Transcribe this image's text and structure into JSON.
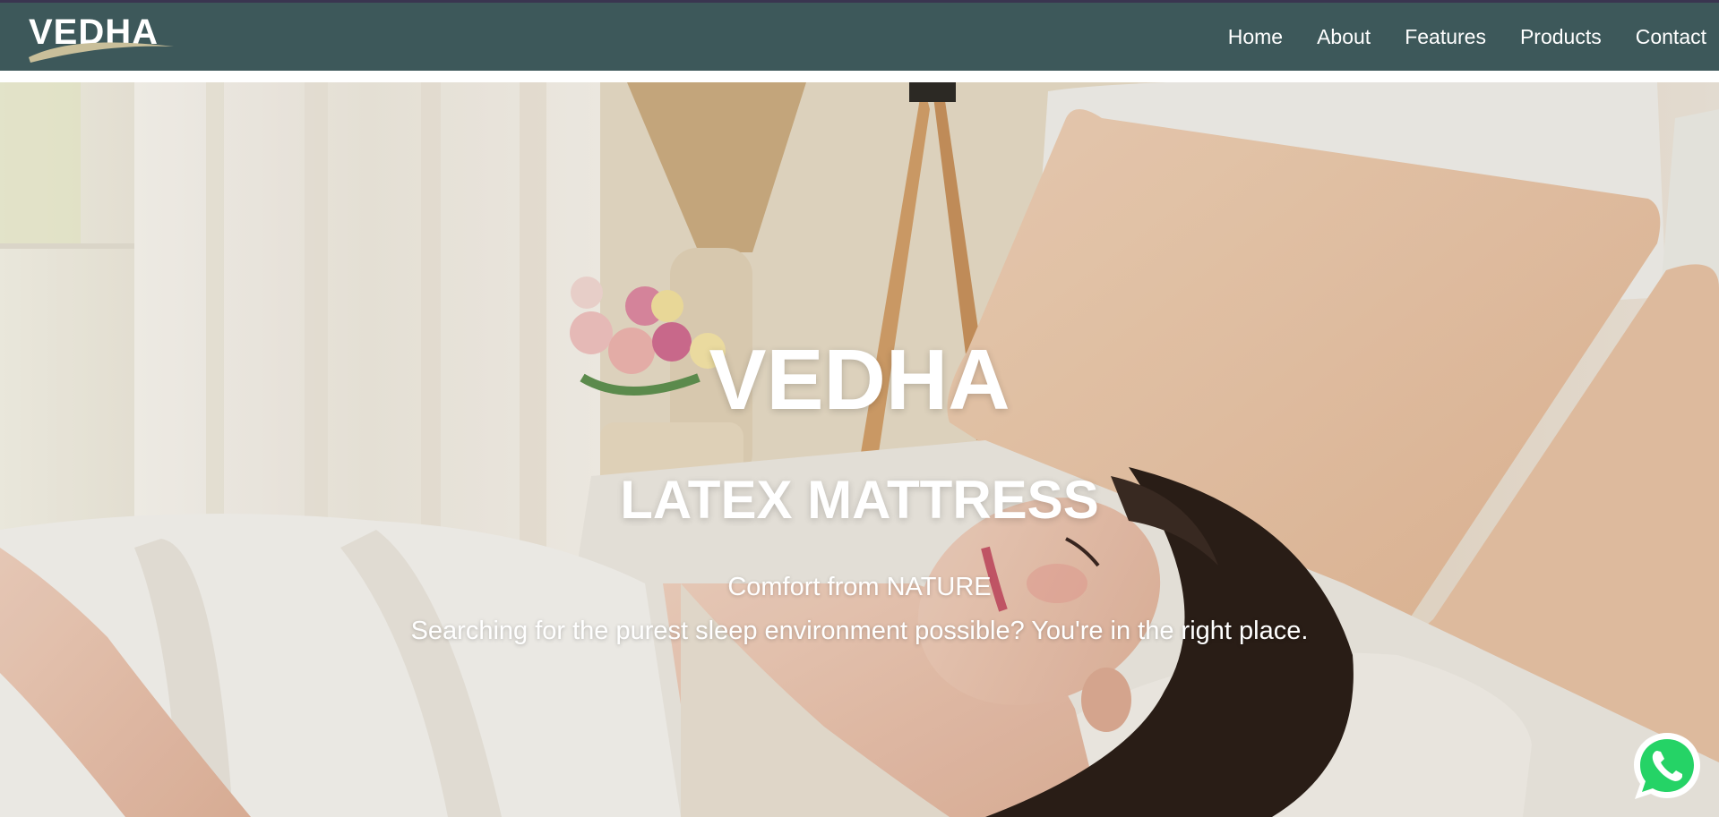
{
  "navbar": {
    "logo_text": "VEDHA",
    "links": [
      {
        "label": "Home"
      },
      {
        "label": "About"
      },
      {
        "label": "Features"
      },
      {
        "label": "Products"
      },
      {
        "label": "Contact"
      }
    ]
  },
  "hero": {
    "title": "VEDHA",
    "subtitle": "LATEX MATTRESS",
    "tagline": "Comfort from NATURE",
    "description": "Searching for the purest sleep environment possible? You're in the right place.",
    "background_image": "woman-sleeping-on-latex-mattress-photo"
  },
  "floating": {
    "whatsapp_icon": "whatsapp-icon"
  },
  "colors": {
    "navbar_bg": "#3d585a",
    "nav_text": "#ffffff",
    "logo_swoosh": "#c9bf9a",
    "whatsapp_green": "#25d366"
  }
}
